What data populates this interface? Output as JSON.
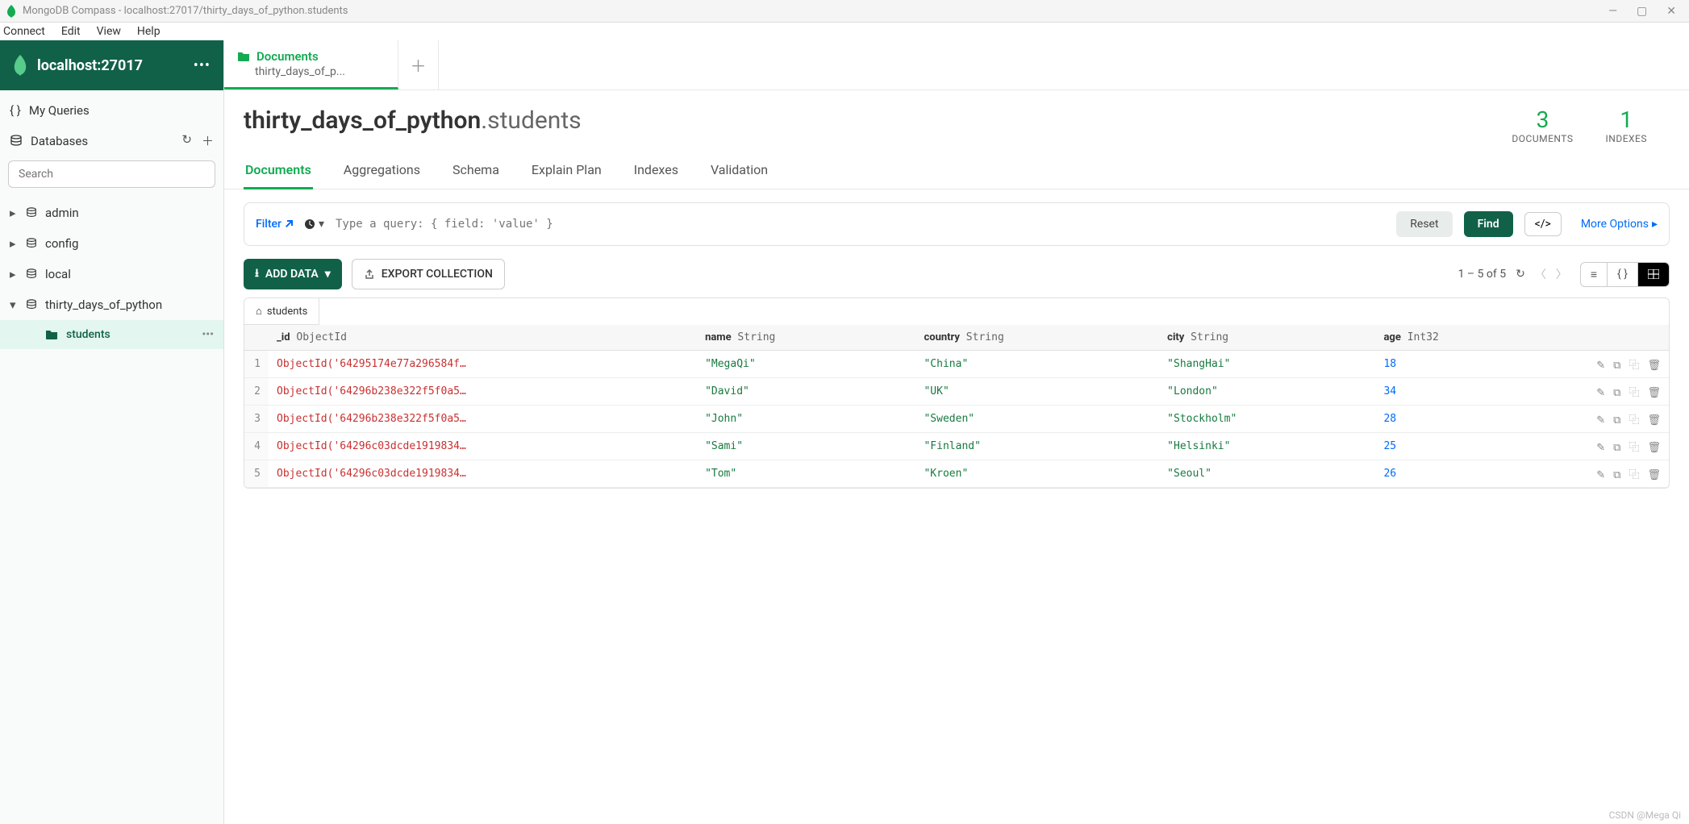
{
  "window": {
    "title": "MongoDB Compass - localhost:27017/thirty_days_of_python.students"
  },
  "menubar": [
    "Connect",
    "Edit",
    "View",
    "Help"
  ],
  "connection": {
    "title": "localhost:27017"
  },
  "sidebar": {
    "my_queries": "My Queries",
    "databases_label": "Databases",
    "search_placeholder": "Search",
    "dbs": [
      "admin",
      "config",
      "local",
      "thirty_days_of_python"
    ],
    "active_collection": "students"
  },
  "tab": {
    "title": "Documents",
    "subtitle": "thirty_days_of_p..."
  },
  "header": {
    "db": "thirty_days_of_python",
    "collection": "students",
    "documents": {
      "count": "3",
      "label": "DOCUMENTS"
    },
    "indexes": {
      "count": "1",
      "label": "INDEXES"
    }
  },
  "subtabs": [
    "Documents",
    "Aggregations",
    "Schema",
    "Explain Plan",
    "Indexes",
    "Validation"
  ],
  "filter": {
    "label": "Filter",
    "placeholder": "Type a query: { field: 'value' }",
    "reset": "Reset",
    "find": "Find",
    "more": "More Options"
  },
  "toolbar": {
    "add": "ADD DATA",
    "export": "EXPORT COLLECTION",
    "pagination": "1 – 5 of 5"
  },
  "table": {
    "tab_label": "students",
    "columns": [
      {
        "field": "_id",
        "type": "ObjectId"
      },
      {
        "field": "name",
        "type": "String"
      },
      {
        "field": "country",
        "type": "String"
      },
      {
        "field": "city",
        "type": "String"
      },
      {
        "field": "age",
        "type": "Int32"
      }
    ],
    "rows": [
      {
        "n": "1",
        "id": "ObjectId('64295174e77a296584f…",
        "name": "\"MegaQi\"",
        "country": "\"China\"",
        "city": "\"ShangHai\"",
        "age": "18"
      },
      {
        "n": "2",
        "id": "ObjectId('64296b238e322f5f0a5…",
        "name": "\"David\"",
        "country": "\"UK\"",
        "city": "\"London\"",
        "age": "34"
      },
      {
        "n": "3",
        "id": "ObjectId('64296b238e322f5f0a5…",
        "name": "\"John\"",
        "country": "\"Sweden\"",
        "city": "\"Stockholm\"",
        "age": "28"
      },
      {
        "n": "4",
        "id": "ObjectId('64296c03dcde1919834…",
        "name": "\"Sami\"",
        "country": "\"Finland\"",
        "city": "\"Helsinki\"",
        "age": "25"
      },
      {
        "n": "5",
        "id": "ObjectId('64296c03dcde1919834…",
        "name": "\"Tom\"",
        "country": "\"Kroen\"",
        "city": "\"Seoul\"",
        "age": "26"
      }
    ]
  },
  "watermark": "CSDN @Mega Qi"
}
